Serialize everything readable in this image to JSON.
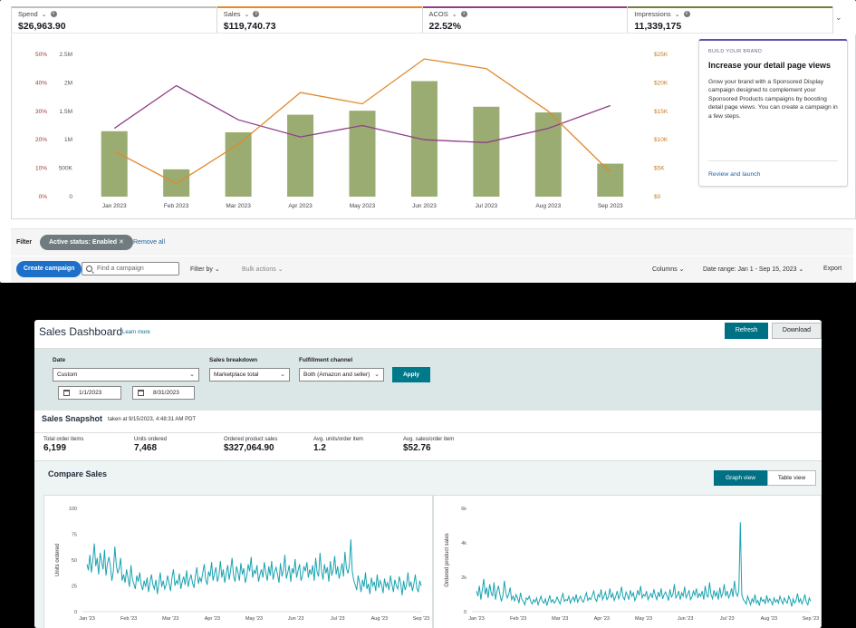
{
  "ads_panel": {
    "metrics": [
      {
        "name": "Spend",
        "value": "$26,963.90",
        "accent": "#bfbfbf"
      },
      {
        "name": "Sales",
        "value": "$119,740.73",
        "accent": "#e58a1f"
      },
      {
        "name": "ACOS",
        "value": "22.52%",
        "accent": "#8c3f82"
      },
      {
        "name": "Impressions",
        "value": "11,339,175",
        "accent": "#6f7f3e"
      }
    ],
    "promo": {
      "eyebrow": "BUILD YOUR BRAND",
      "title": "Increase your detail page views",
      "body": "Grow your brand with a Sponsored Display campaign designed to complement your Sponsored Products campaigns by boosting detail page views. You can create a campaign in a few steps.",
      "link": "Review and launch"
    },
    "filter": {
      "label": "Filter",
      "chip": "Active status: Enabled",
      "remove_all": "Remove all"
    },
    "actions": {
      "create": "Create campaign",
      "search_placeholder": "Find a campaign",
      "filter_by": "Filter by",
      "bulk": "Bulk actions",
      "columns": "Columns",
      "date_range": "Date range: Jan 1 - Sep 15, 2023",
      "export": "Export"
    }
  },
  "chart_data": [
    {
      "type": "bar",
      "categories": [
        "Jan 2023",
        "Feb 2023",
        "Mar 2023",
        "Apr 2023",
        "May 2023",
        "Jun 2023",
        "Jul 2023",
        "Aug 2023",
        "Sep 2023"
      ],
      "y_left_pct_ticks": [
        "0%",
        "10%",
        "20%",
        "30%",
        "40%",
        "50%"
      ],
      "y_left_count_ticks": [
        "0",
        "500K",
        "1M",
        "1.5M",
        "2M",
        "2.5M"
      ],
      "y_right_ticks": [
        "$0",
        "$5K",
        "$10K",
        "$15K",
        "$20K",
        "$25K"
      ],
      "ylim_impressions": [
        0,
        2500000
      ],
      "ylim_acos": [
        0,
        50
      ],
      "ylim_dollars": [
        0,
        25000
      ],
      "series": [
        {
          "name": "Impressions",
          "kind": "bar",
          "color": "#9aac72",
          "values": [
            1150000,
            480000,
            1130000,
            1440000,
            1510000,
            2030000,
            1580000,
            1480000,
            580000
          ]
        },
        {
          "name": "ACOS",
          "kind": "line",
          "color": "#8e3f86",
          "values": [
            24,
            39,
            27,
            21,
            25,
            20,
            19,
            24,
            32
          ]
        },
        {
          "name": "Sales",
          "kind": "line",
          "color": "#e08a2b",
          "values": [
            8000,
            2300,
            9200,
            18300,
            16300,
            24200,
            22500,
            15000,
            4300
          ]
        }
      ]
    },
    {
      "type": "line",
      "ylabel": "Units ordered",
      "x_ticks": [
        "Jan '23",
        "Feb '23",
        "Mar '23",
        "Apr '23",
        "May '23",
        "Jun '23",
        "Jul '23",
        "Aug '23",
        "Sep '23"
      ],
      "y_ticks": [
        "0",
        "25",
        "50",
        "75",
        "100"
      ],
      "ylim": [
        0,
        100
      ],
      "color": "#1aa3b0",
      "values": [
        46,
        40,
        55,
        38,
        50,
        66,
        44,
        52,
        36,
        57,
        48,
        41,
        60,
        35,
        47,
        53,
        44,
        30,
        39,
        63,
        45,
        37,
        42,
        52,
        30,
        36,
        28,
        41,
        33,
        24,
        45,
        31,
        27,
        22,
        35,
        29,
        38,
        26,
        21,
        30,
        24,
        33,
        19,
        28,
        36,
        26,
        22,
        31,
        17,
        27,
        38,
        24,
        30,
        22,
        26,
        35,
        28,
        20,
        33,
        41,
        25,
        30,
        27,
        37,
        22,
        29,
        34,
        26,
        40,
        24,
        31,
        36,
        28,
        23,
        35,
        43,
        27,
        33,
        29,
        38,
        46,
        31,
        26,
        39,
        34,
        48,
        30,
        37,
        43,
        29,
        35,
        49,
        33,
        41,
        28,
        37,
        45,
        31,
        40,
        52,
        35,
        29,
        44,
        38,
        30,
        47,
        36,
        42,
        28,
        34,
        46,
        39,
        53,
        33,
        40,
        37,
        45,
        29,
        36,
        41,
        33,
        48,
        38,
        30,
        44,
        35,
        49,
        31,
        39,
        43,
        36,
        28,
        47,
        34,
        40,
        55,
        32,
        38,
        45,
        29,
        42,
        37,
        51,
        33,
        40,
        46,
        30,
        35,
        44,
        39,
        48,
        33,
        41,
        36,
        45,
        30,
        52,
        38,
        34,
        57,
        40,
        31,
        46,
        37,
        43,
        29,
        49,
        35,
        41,
        54,
        36,
        44,
        32,
        39,
        47,
        34,
        58,
        42,
        37,
        45,
        70,
        39,
        30,
        26,
        21,
        35,
        28,
        19,
        31,
        24,
        38,
        22,
        27,
        17,
        33,
        25,
        29,
        20,
        36,
        23,
        30,
        26,
        18,
        32,
        24,
        28,
        21,
        35,
        27,
        19,
        31,
        25,
        22,
        34,
        28,
        16,
        30,
        21,
        26,
        38,
        24,
        29,
        20,
        27,
        36,
        23,
        19,
        30,
        25
      ]
    },
    {
      "type": "line",
      "ylabel": "Ordered product sales",
      "x_ticks": [
        "Jan '23",
        "Feb '23",
        "Mar '23",
        "Apr '23",
        "May '23",
        "Jun '23",
        "Jul '23",
        "Aug '23",
        "Sep '23"
      ],
      "y_ticks": [
        "0",
        "2k",
        "4k",
        "6k"
      ],
      "ylim": [
        0,
        6000
      ],
      "color": "#1aa3b0",
      "values": [
        1200,
        900,
        1500,
        700,
        1300,
        1900,
        1000,
        1400,
        800,
        1600,
        1100,
        900,
        1700,
        700,
        1200,
        1500,
        1000,
        600,
        900,
        1800,
        1100,
        800,
        1000,
        1400,
        700,
        900,
        600,
        1000,
        800,
        500,
        1100,
        700,
        600,
        400,
        800,
        700,
        900,
        600,
        450,
        700,
        550,
        800,
        400,
        650,
        900,
        600,
        500,
        750,
        350,
        650,
        950,
        550,
        700,
        500,
        600,
        850,
        650,
        450,
        800,
        1050,
        600,
        700,
        650,
        900,
        500,
        700,
        850,
        600,
        1000,
        550,
        750,
        900,
        650,
        550,
        850,
        1100,
        650,
        800,
        700,
        950,
        1200,
        750,
        600,
        1000,
        850,
        1300,
        700,
        900,
        1150,
        700,
        850,
        1350,
        800,
        1050,
        650,
        900,
        1200,
        750,
        1000,
        1450,
        850,
        700,
        1150,
        950,
        700,
        1250,
        900,
        1100,
        650,
        850,
        1250,
        950,
        1500,
        800,
        1000,
        900,
        1200,
        700,
        900,
        1050,
        800,
        1300,
        950,
        700,
        1150,
        850,
        1350,
        750,
        1000,
        1150,
        900,
        650,
        1300,
        850,
        1000,
        1600,
        800,
        950,
        1200,
        700,
        1100,
        900,
        1450,
        800,
        1000,
        1250,
        700,
        850,
        1200,
        950,
        1350,
        800,
        1050,
        900,
        1200,
        700,
        1500,
        950,
        850,
        1700,
        1000,
        750,
        1250,
        900,
        1150,
        700,
        1400,
        850,
        1050,
        1600,
        900,
        1200,
        800,
        1000,
        1350,
        850,
        1800,
        1100,
        900,
        1250,
        5200,
        1000,
        700,
        600,
        450,
        900,
        650,
        400,
        750,
        550,
        1000,
        500,
        650,
        350,
        850,
        600,
        700,
        450,
        950,
        550,
        750,
        600,
        400,
        800,
        550,
        700,
        500,
        900,
        650,
        450,
        800,
        600,
        500,
        900,
        700,
        300,
        750,
        500,
        650,
        1050,
        550,
        750,
        450,
        650,
        1000,
        550,
        400,
        800,
        600
      ]
    }
  ],
  "dashboard": {
    "title": "Sales Dashboard",
    "learn_more": "Learn more",
    "refresh": "Refresh",
    "download": "Download",
    "date_label": "Date",
    "date_value": "Custom",
    "date_from": "1/1/2023",
    "date_to": "8/31/2023",
    "breakdown_label": "Sales breakdown",
    "breakdown_value": "Marketplace total",
    "channel_label": "Fulfillment channel",
    "channel_value": "Both (Amazon and seller)",
    "apply": "Apply",
    "snapshot_title": "Sales Snapshot",
    "snapshot_time": "taken at 9/15/2023, 4:48:31 AM PDT",
    "kpis": [
      {
        "label": "Total order items",
        "value": "6,199"
      },
      {
        "label": "Units ordered",
        "value": "7,468"
      },
      {
        "label": "Ordered product sales",
        "value": "$327,064.90"
      },
      {
        "label": "Avg. units/order item",
        "value": "1.2"
      },
      {
        "label": "Avg. sales/order item",
        "value": "$52.76"
      }
    ],
    "compare_title": "Compare Sales",
    "graph_view": "Graph view",
    "table_view": "Table view"
  }
}
